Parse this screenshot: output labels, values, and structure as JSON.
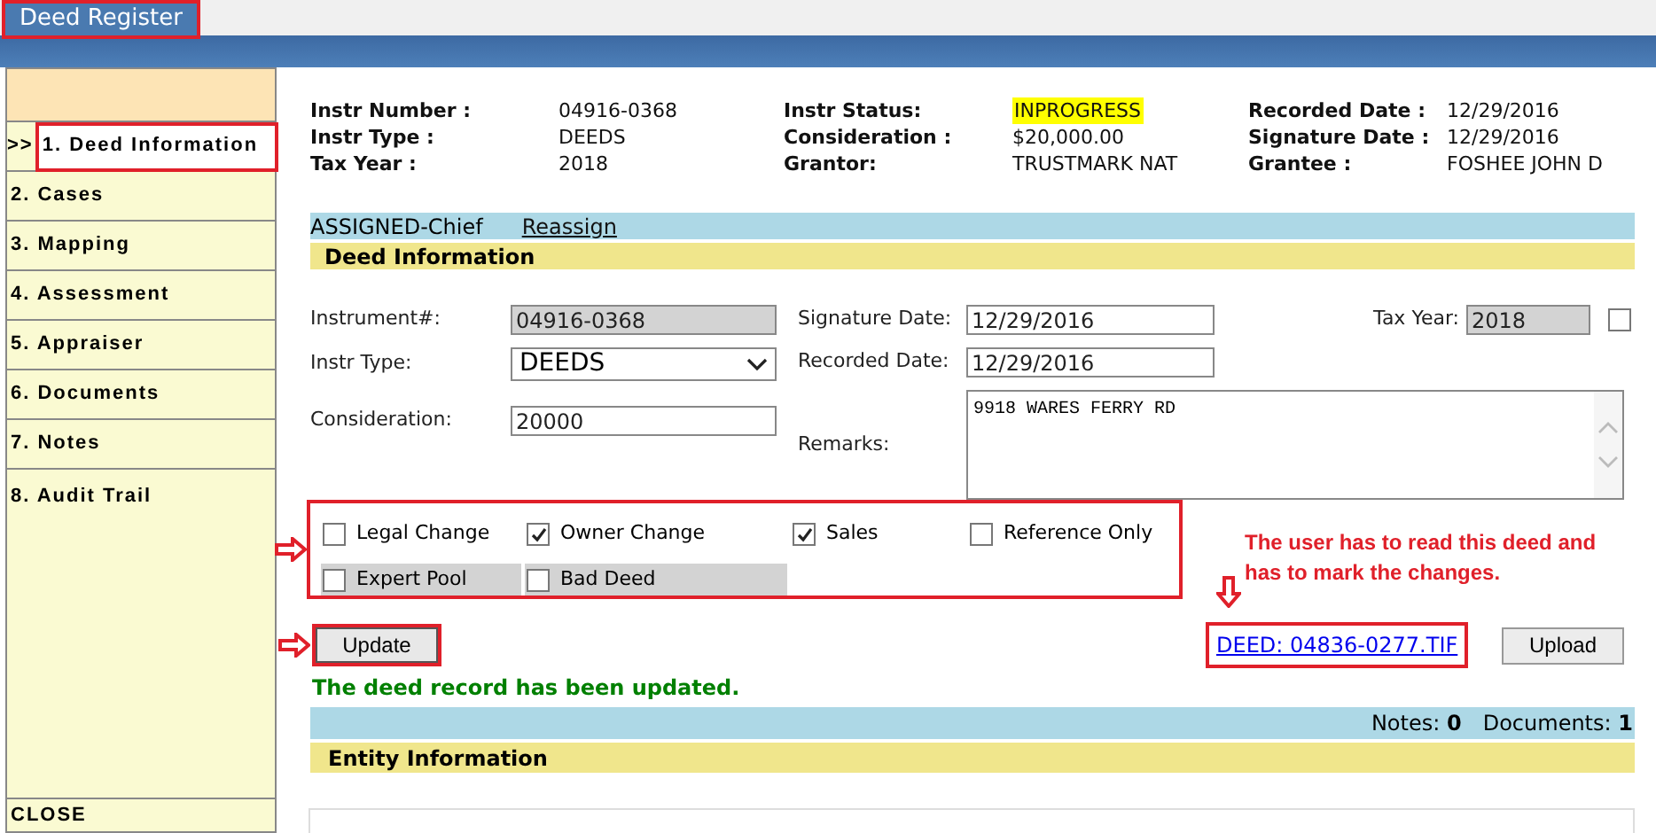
{
  "app_tab": {
    "label": "Deed Register",
    "annotated": true
  },
  "sidebar": {
    "items": [
      {
        "label": "1. Deed Information",
        "selected": true,
        "marker": ">>",
        "annotated": true
      },
      {
        "label": "2. Cases",
        "selected": false
      },
      {
        "label": "3. Mapping",
        "selected": false
      },
      {
        "label": "4. Assessment",
        "selected": false
      },
      {
        "label": "5. Appraiser",
        "selected": false
      },
      {
        "label": "6. Documents",
        "selected": false
      },
      {
        "label": "7. Notes",
        "selected": false
      },
      {
        "label": "8. Audit Trail",
        "selected": false
      }
    ],
    "close": "CLOSE"
  },
  "summary": {
    "columns": [
      [
        {
          "label": "Instr Number :",
          "value": "04916-0368",
          "highlight": false
        },
        {
          "label": "Instr Type :",
          "value": "DEEDS",
          "highlight": false
        },
        {
          "label": "Tax Year :",
          "value": "2018",
          "highlight": false
        }
      ],
      [
        {
          "label": "Instr Status:",
          "value": "INPROGRESS",
          "highlight": true
        },
        {
          "label": "Consideration :",
          "value": "$20,000.00",
          "highlight": false
        },
        {
          "label": "Grantor:",
          "value": "TRUSTMARK NAT",
          "highlight": false
        }
      ],
      [
        {
          "label": "Recorded Date :",
          "value": "12/29/2016",
          "highlight": false
        },
        {
          "label": "Signature Date :",
          "value": "12/29/2016",
          "highlight": false
        },
        {
          "label": "Grantee :",
          "value": "FOSHEE JOHN D",
          "highlight": false
        }
      ]
    ]
  },
  "assignment": {
    "text": "ASSIGNED-Chief",
    "link": "Reassign"
  },
  "deed_section": {
    "title": "Deed Information"
  },
  "form": {
    "instrument": {
      "label": "Instrument#:",
      "value": "04916-0368",
      "disabled": true
    },
    "signature_date": {
      "label": "Signature Date:",
      "value": "12/29/2016"
    },
    "tax_year": {
      "label": "Tax Year:",
      "value": "2018",
      "disabled": true,
      "checked": false
    },
    "instr_type": {
      "label": "Instr Type:",
      "value": "DEEDS"
    },
    "recorded_date": {
      "label": "Recorded Date:",
      "value": "12/29/2016"
    },
    "consideration": {
      "label": "Consideration:",
      "value": "20000"
    },
    "remarks": {
      "label": "Remarks:",
      "value": "9918 WARES FERRY RD"
    }
  },
  "flags": {
    "annotated": true,
    "items": [
      {
        "label": "Legal Change",
        "checked": false,
        "shaded": false
      },
      {
        "label": "Owner Change",
        "checked": true,
        "shaded": false
      },
      {
        "label": "Sales",
        "checked": true,
        "shaded": false
      },
      {
        "label": "Reference Only",
        "checked": false,
        "shaded": false
      },
      {
        "label": "Expert Pool",
        "checked": false,
        "shaded": true
      },
      {
        "label": "Bad Deed",
        "checked": false,
        "shaded": true
      }
    ]
  },
  "annotation_note": "The user has to read this deed and has to mark the changes.",
  "update_button": {
    "label": "Update",
    "annotated": true
  },
  "deed_link": {
    "label": "DEED: 04836-0277.TIF",
    "annotated": true
  },
  "upload_button": "Upload",
  "message": "The deed record has been updated.",
  "counts": [
    {
      "label": "Notes:",
      "value": "0"
    },
    {
      "label": "Documents:",
      "value": "1"
    }
  ],
  "entity_section": {
    "title": "Entity Information"
  }
}
